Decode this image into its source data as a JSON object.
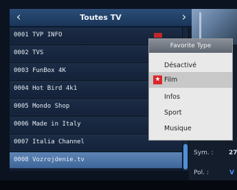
{
  "header": {
    "title": "Toutes TV",
    "left_arrow": "‹",
    "right_arrow": "›"
  },
  "channels": [
    {
      "label": "0001 TVP INFO"
    },
    {
      "label": "0002 TVS"
    },
    {
      "label": "0003 FunBox 4K"
    },
    {
      "label": "0004 Hot Bird 4k1"
    },
    {
      "label": "0005 Mondo Shop"
    },
    {
      "label": "0006 Made in Italy"
    },
    {
      "label": "0007 Italia Channel"
    },
    {
      "label": "0008 Vozrojdenie.tv"
    }
  ],
  "popup": {
    "title": "Favorite Type",
    "items": [
      {
        "label": "Désactivé"
      },
      {
        "label": "Film"
      },
      {
        "label": "Infos"
      },
      {
        "label": "Sport"
      },
      {
        "label": "Musique"
      }
    ],
    "selected_index": 1
  },
  "info": {
    "sym_label": "Sym. :",
    "sym_value": "27",
    "pol_label": "Pol. :",
    "pol_value": "V"
  },
  "colors": {
    "accent": "#4e8ef0",
    "selected_row": "#5d84b4",
    "favorite_star": "#d8282c"
  }
}
